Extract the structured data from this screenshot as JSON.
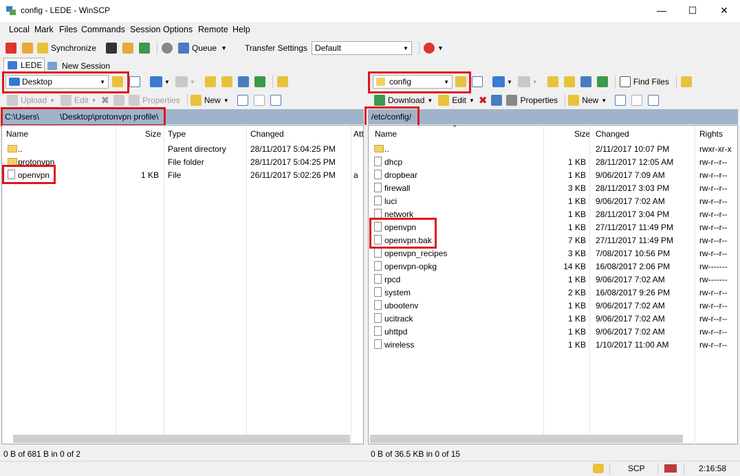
{
  "window": {
    "title": "config - LEDE - WinSCP",
    "minimize": "—",
    "maximize": "☐",
    "close": "✕"
  },
  "menu": [
    "Local",
    "Mark",
    "Files",
    "Commands",
    "Session",
    "Options",
    "Remote",
    "Help"
  ],
  "toolbar": {
    "synchronize": "Synchronize",
    "queue": "Queue",
    "transfer_settings_label": "Transfer Settings",
    "transfer_settings_value": "Default"
  },
  "tabs": {
    "session": "LEDE",
    "new_session": "New Session"
  },
  "left": {
    "location": "Desktop",
    "actions": {
      "upload": "Upload",
      "edit": "Edit",
      "properties": "Properties",
      "new": "New"
    },
    "path": "C:\\Users\\         \\Desktop\\protonvpn profile\\",
    "columns": {
      "name": "Name",
      "size": "Size",
      "type": "Type",
      "changed": "Changed",
      "attr": "Att"
    },
    "rows": [
      {
        "name": "..",
        "size": "",
        "type": "Parent directory",
        "changed": "28/11/2017  5:04:25 PM",
        "attr": "",
        "kind": "up"
      },
      {
        "name": "protonvpn",
        "size": "",
        "type": "File folder",
        "changed": "28/11/2017  5:04:25 PM",
        "attr": "",
        "kind": "folder"
      },
      {
        "name": "openvpn",
        "size": "1 KB",
        "type": "File",
        "changed": "26/11/2017  5:02:26 PM",
        "attr": "a",
        "kind": "file"
      }
    ],
    "status": "0 B of 681 B in 0 of 2"
  },
  "right": {
    "location": "config",
    "actions": {
      "download": "Download",
      "edit": "Edit",
      "properties": "Properties",
      "new": "New",
      "find_files": "Find Files"
    },
    "path": "/etc/config/",
    "columns": {
      "name": "Name",
      "size": "Size",
      "changed": "Changed",
      "rights": "Rights"
    },
    "rows": [
      {
        "name": "..",
        "size": "",
        "changed": "2/11/2017 10:07 PM",
        "rights": "rwxr-xr-x",
        "kind": "up"
      },
      {
        "name": "dhcp",
        "size": "1 KB",
        "changed": "28/11/2017 12:05 AM",
        "rights": "rw-r--r--",
        "kind": "file"
      },
      {
        "name": "dropbear",
        "size": "1 KB",
        "changed": "9/06/2017 7:09 AM",
        "rights": "rw-r--r--",
        "kind": "file"
      },
      {
        "name": "firewall",
        "size": "3 KB",
        "changed": "28/11/2017 3:03 PM",
        "rights": "rw-r--r--",
        "kind": "file"
      },
      {
        "name": "luci",
        "size": "1 KB",
        "changed": "9/06/2017 7:02 AM",
        "rights": "rw-r--r--",
        "kind": "file"
      },
      {
        "name": "network",
        "size": "1 KB",
        "changed": "28/11/2017 3:04 PM",
        "rights": "rw-r--r--",
        "kind": "file"
      },
      {
        "name": "openvpn",
        "size": "1 KB",
        "changed": "27/11/2017 11:49 PM",
        "rights": "rw-r--r--",
        "kind": "file"
      },
      {
        "name": "openvpn.bak",
        "size": "7 KB",
        "changed": "27/11/2017 11:49 PM",
        "rights": "rw-r--r--",
        "kind": "file"
      },
      {
        "name": "openvpn_recipes",
        "size": "3 KB",
        "changed": "7/08/2017 10:56 PM",
        "rights": "rw-r--r--",
        "kind": "file"
      },
      {
        "name": "openvpn-opkg",
        "size": "14 KB",
        "changed": "16/08/2017 2:06 PM",
        "rights": "rw-------",
        "kind": "file"
      },
      {
        "name": "rpcd",
        "size": "1 KB",
        "changed": "9/06/2017 7:02 AM",
        "rights": "rw-------",
        "kind": "file"
      },
      {
        "name": "system",
        "size": "2 KB",
        "changed": "16/08/2017 9:26 PM",
        "rights": "rw-r--r--",
        "kind": "file"
      },
      {
        "name": "ubootenv",
        "size": "1 KB",
        "changed": "9/06/2017 7:02 AM",
        "rights": "rw-r--r--",
        "kind": "file"
      },
      {
        "name": "ucitrack",
        "size": "1 KB",
        "changed": "9/06/2017 7:02 AM",
        "rights": "rw-r--r--",
        "kind": "file"
      },
      {
        "name": "uhttpd",
        "size": "1 KB",
        "changed": "9/06/2017 7:02 AM",
        "rights": "rw-r--r--",
        "kind": "file"
      },
      {
        "name": "wireless",
        "size": "1 KB",
        "changed": "1/10/2017 11:00 AM",
        "rights": "rw-r--r--",
        "kind": "file"
      }
    ],
    "status": "0 B of 36.5 KB in 0 of 15"
  },
  "statusbar": {
    "protocol": "SCP",
    "time": "2:16:58"
  },
  "colors": {
    "highlight": "#e0141e",
    "pathbar": "#9fb4cb"
  }
}
